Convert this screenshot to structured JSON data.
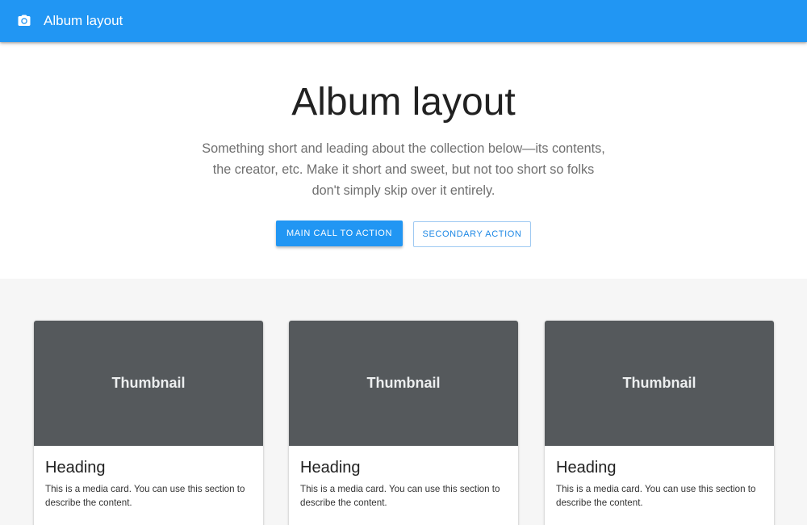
{
  "appbar": {
    "icon": "camera-icon",
    "title": "Album layout",
    "color": "#2196f3"
  },
  "hero": {
    "title": "Album layout",
    "description": "Something short and leading about the collection below—its contents, the creator, etc. Make it short and sweet, but not too short so folks don't simply skip over it entirely.",
    "primary_action": "Main call to action",
    "secondary_action": "Secondary action"
  },
  "cards": [
    {
      "thumbnail": "Thumbnail",
      "heading": "Heading",
      "description": "This is a media card. You can use this section to describe the content."
    },
    {
      "thumbnail": "Thumbnail",
      "heading": "Heading",
      "description": "This is a media card. You can use this section to describe the content."
    },
    {
      "thumbnail": "Thumbnail",
      "heading": "Heading",
      "description": "This is a media card. You can use this section to describe the content."
    }
  ],
  "colors": {
    "primary": "#2196f3",
    "thumbnail_bg": "#55595c",
    "content_bg": "#f6f6f6"
  }
}
